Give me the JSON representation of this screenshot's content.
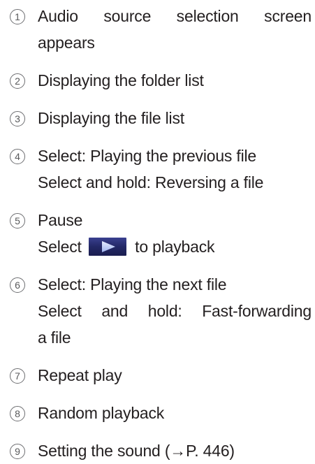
{
  "items": [
    {
      "number": "1",
      "lines": [
        "Audio source selection screen",
        "appears"
      ]
    },
    {
      "number": "2",
      "lines": [
        "Displaying the folder list"
      ]
    },
    {
      "number": "3",
      "lines": [
        "Displaying the file list"
      ]
    },
    {
      "number": "4",
      "lines": [
        "Select: Playing the previous file",
        "Select and hold: Reversing a file"
      ]
    },
    {
      "number": "5",
      "lines": [
        "Pause",
        "Select",
        "to playback"
      ]
    },
    {
      "number": "6",
      "lines": [
        "Select: Playing the next file",
        "Select and hold: Fast-forwarding",
        "a file"
      ]
    },
    {
      "number": "7",
      "lines": [
        "Repeat play"
      ]
    },
    {
      "number": "8",
      "lines": [
        "Random playback"
      ]
    },
    {
      "number": "9",
      "lines": [
        "Setting the sound (→P. 446)"
      ]
    }
  ],
  "icons": {
    "play_button": "play-icon"
  },
  "colors": {
    "text": "#231f20",
    "number_circle": "#6d6e71",
    "play_button_bg": "#2a2f6e",
    "play_arrow": "#c9d6ff"
  }
}
